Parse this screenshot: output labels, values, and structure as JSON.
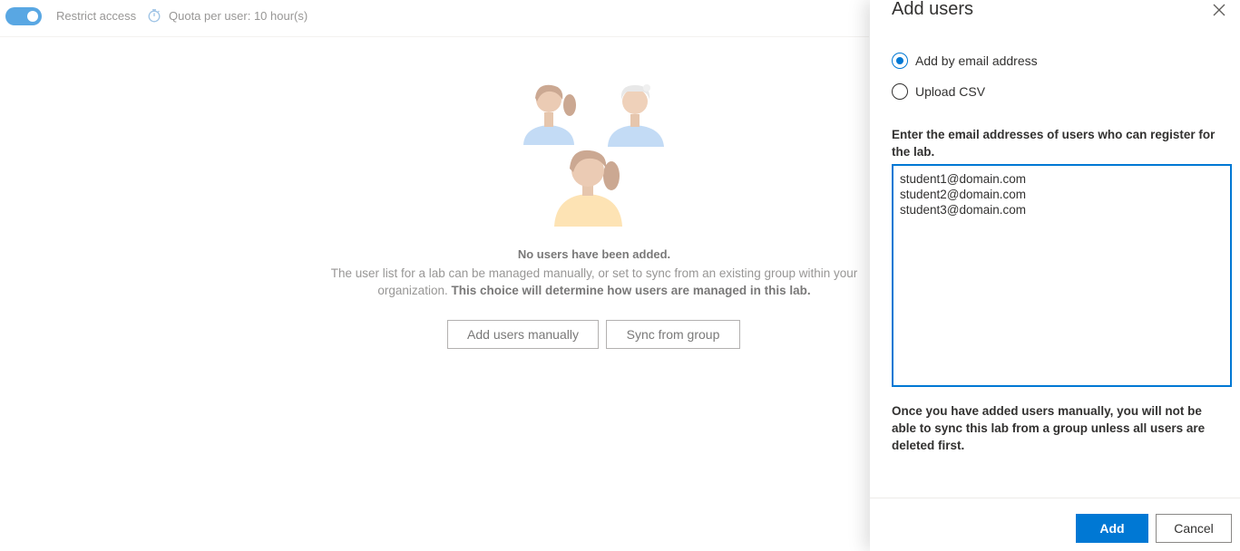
{
  "toolbar": {
    "restrict_access_label": "Restrict access",
    "restrict_access_on": true,
    "quota_label": "Quota per user: 10 hour(s)"
  },
  "empty_state": {
    "title": "No users have been added.",
    "description_part1": "The user list for a lab can be managed manually, or set to sync from an existing group within your organization.",
    "description_part2": "This choice will determine how users are managed in this lab.",
    "add_manually_label": "Add users manually",
    "sync_group_label": "Sync from group"
  },
  "panel": {
    "title": "Add users",
    "options": [
      {
        "label": "Add by email address",
        "selected": true
      },
      {
        "label": "Upload CSV",
        "selected": false
      }
    ],
    "field_label": "Enter the email addresses of users who can register for the lab.",
    "emails_value": "student1@domain.com\nstudent2@domain.com\nstudent3@domain.com",
    "warning": "Once you have added users manually, you will not be able to sync this lab from a group unless all users are deleted first.",
    "add_label": "Add",
    "cancel_label": "Cancel"
  },
  "colors": {
    "accent": "#0078d4",
    "text": "#323130",
    "subtle_text": "#605e5c",
    "border": "#8a8886"
  }
}
